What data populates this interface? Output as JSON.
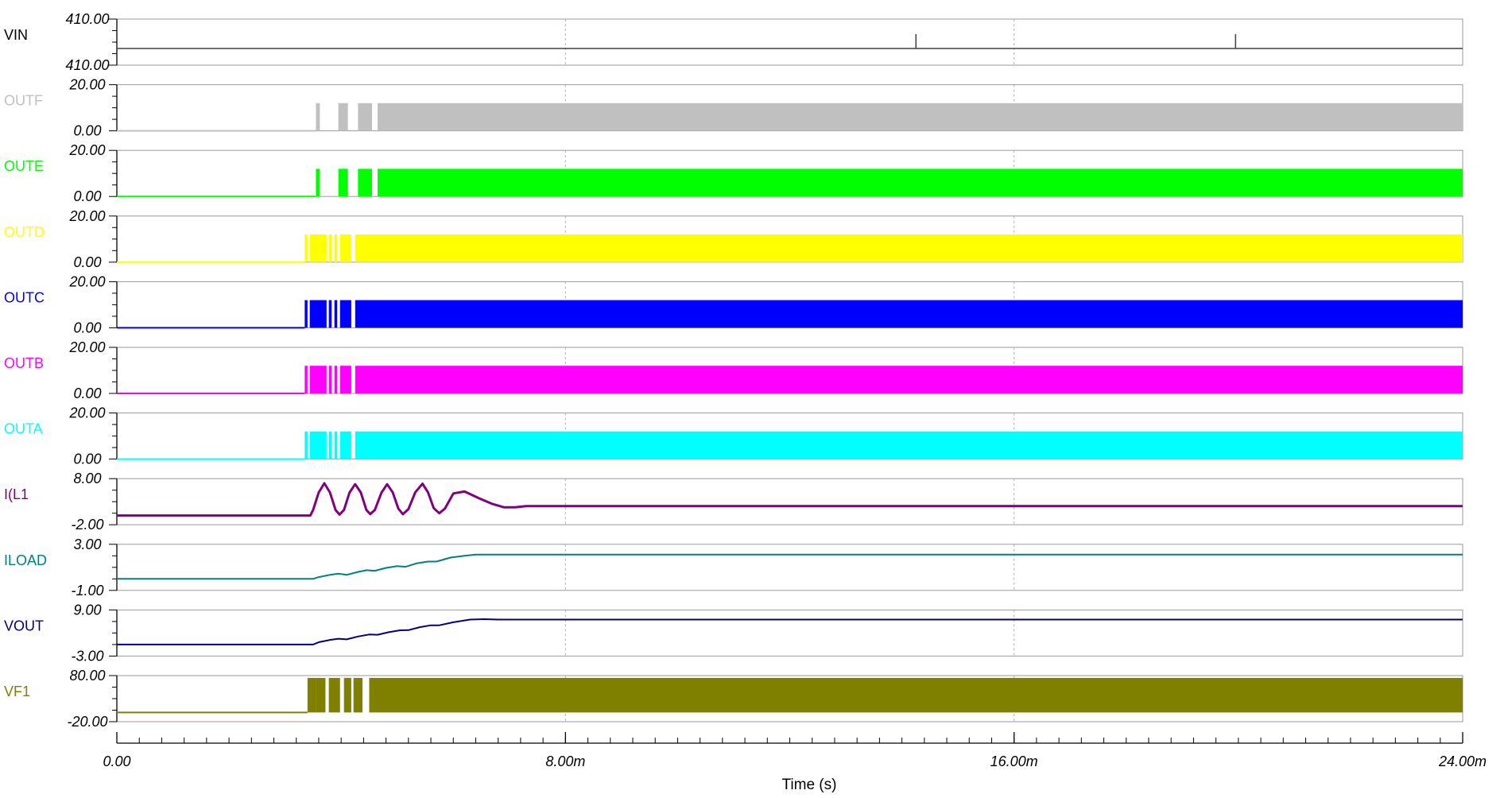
{
  "chart_data": {
    "type": "line",
    "title": "",
    "xlabel": "Time (s)",
    "x_range": [
      0,
      24
    ],
    "x_unit": "ms",
    "x_ticks": [
      0,
      8,
      16,
      24
    ],
    "x_tick_labels": [
      "0.00",
      "8.00m",
      "16.00m",
      "24.00m"
    ],
    "grid": "dashed vertical lines at each labeled x tick",
    "traces": [
      {
        "name": "VIN",
        "color": "#000000",
        "line_color": "#404040",
        "y_top": 410,
        "y_bottom": 410,
        "top_label": "410.00",
        "bottom_label": "410.00",
        "kind": "flat",
        "spikes_x": [
          14.25,
          19.95
        ]
      },
      {
        "name": "OUTF",
        "color": "#c0c0c0",
        "y_top": 20,
        "y_bottom": 0,
        "top_label": "20.00",
        "bottom_label": "0.00",
        "kind": "pwm",
        "high": 12,
        "start": 3.55,
        "steady_from": 4.65,
        "bursts": [
          [
            3.55,
            3.62
          ],
          [
            3.95,
            4.12
          ],
          [
            4.3,
            4.55
          ]
        ]
      },
      {
        "name": "OUTE",
        "color": "#00ff00",
        "y_top": 20,
        "y_bottom": 0,
        "top_label": "20.00",
        "bottom_label": "0.00",
        "kind": "pwm",
        "high": 12,
        "start": 3.55,
        "steady_from": 4.65,
        "bursts": [
          [
            3.55,
            3.62
          ],
          [
            3.95,
            4.12
          ],
          [
            4.3,
            4.55
          ]
        ]
      },
      {
        "name": "OUTD",
        "color": "#ffff00",
        "y_top": 20,
        "y_bottom": 0,
        "top_label": "20.00",
        "bottom_label": "0.00",
        "kind": "pwm",
        "high": 12,
        "start": 3.35,
        "steady_from": 4.25,
        "bursts": [
          [
            3.35,
            3.4
          ],
          [
            3.44,
            3.74
          ],
          [
            3.78,
            3.83
          ],
          [
            3.88,
            3.93
          ],
          [
            3.98,
            4.18
          ]
        ]
      },
      {
        "name": "OUTC",
        "color": "#0000ff",
        "y_top": 20,
        "y_bottom": 0,
        "top_label": "20.00",
        "bottom_label": "0.00",
        "kind": "pwm",
        "high": 12,
        "start": 3.35,
        "steady_from": 4.25,
        "bursts": [
          [
            3.35,
            3.4
          ],
          [
            3.44,
            3.74
          ],
          [
            3.78,
            3.83
          ],
          [
            3.88,
            3.93
          ],
          [
            3.98,
            4.18
          ]
        ]
      },
      {
        "name": "OUTB",
        "color": "#ff00ff",
        "y_top": 20,
        "y_bottom": 0,
        "top_label": "20.00",
        "bottom_label": "0.00",
        "kind": "pwm",
        "high": 12,
        "start": 3.35,
        "steady_from": 4.25,
        "bursts": [
          [
            3.35,
            3.4
          ],
          [
            3.44,
            3.74
          ],
          [
            3.78,
            3.83
          ],
          [
            3.88,
            3.93
          ],
          [
            3.98,
            4.18
          ]
        ]
      },
      {
        "name": "OUTA",
        "color": "#00ffff",
        "y_top": 20,
        "y_bottom": 0,
        "top_label": "20.00",
        "bottom_label": "0.00",
        "kind": "pwm",
        "high": 12,
        "start": 3.35,
        "steady_from": 4.25,
        "bursts": [
          [
            3.35,
            3.4
          ],
          [
            3.44,
            3.74
          ],
          [
            3.78,
            3.83
          ],
          [
            3.88,
            3.93
          ],
          [
            3.98,
            4.18
          ]
        ]
      },
      {
        "name": "I(L1",
        "color": "#800080",
        "y_top": 8,
        "y_bottom": -2,
        "top_label": "8.00",
        "bottom_label": "-2.00",
        "kind": "curve",
        "stroke": 3,
        "points": [
          [
            0,
            0
          ],
          [
            3.45,
            0
          ],
          [
            3.5,
            1.2
          ],
          [
            3.6,
            5.0
          ],
          [
            3.7,
            7.0
          ],
          [
            3.8,
            5.0
          ],
          [
            3.9,
            1.2
          ],
          [
            3.97,
            0.2
          ],
          [
            4.05,
            1.2
          ],
          [
            4.15,
            5.0
          ],
          [
            4.25,
            6.8
          ],
          [
            4.35,
            5.0
          ],
          [
            4.45,
            1.2
          ],
          [
            4.52,
            0.3
          ],
          [
            4.6,
            1.2
          ],
          [
            4.72,
            5.0
          ],
          [
            4.82,
            6.8
          ],
          [
            4.92,
            5.0
          ],
          [
            5.02,
            1.5
          ],
          [
            5.1,
            0.3
          ],
          [
            5.2,
            1.4
          ],
          [
            5.32,
            5.0
          ],
          [
            5.45,
            6.9
          ],
          [
            5.55,
            5.0
          ],
          [
            5.65,
            1.6
          ],
          [
            5.75,
            0.5
          ],
          [
            5.85,
            1.5
          ],
          [
            6.0,
            4.8
          ],
          [
            6.2,
            5.2
          ],
          [
            6.45,
            3.8
          ],
          [
            6.7,
            2.5
          ],
          [
            6.9,
            1.8
          ],
          [
            7.1,
            1.8
          ],
          [
            7.3,
            2.05
          ],
          [
            24,
            2.05
          ]
        ]
      },
      {
        "name": "ILOAD",
        "color": "#008080",
        "y_top": 3,
        "y_bottom": -1,
        "top_label": "3.00",
        "bottom_label": "-1.00",
        "kind": "curve",
        "stroke": 2,
        "points": [
          [
            0,
            0
          ],
          [
            3.5,
            0
          ],
          [
            3.6,
            0.15
          ],
          [
            3.8,
            0.35
          ],
          [
            3.95,
            0.45
          ],
          [
            4.1,
            0.35
          ],
          [
            4.3,
            0.6
          ],
          [
            4.45,
            0.75
          ],
          [
            4.6,
            0.7
          ],
          [
            4.8,
            0.95
          ],
          [
            5.0,
            1.1
          ],
          [
            5.15,
            1.05
          ],
          [
            5.35,
            1.35
          ],
          [
            5.55,
            1.5
          ],
          [
            5.7,
            1.5
          ],
          [
            5.95,
            1.85
          ],
          [
            6.2,
            2.0
          ],
          [
            6.4,
            2.1
          ],
          [
            24,
            2.1
          ]
        ]
      },
      {
        "name": "VOUT",
        "color": "#000080",
        "y_top": 9,
        "y_bottom": -3,
        "top_label": "9.00",
        "bottom_label": "-3.00",
        "kind": "curve",
        "stroke": 2,
        "points": [
          [
            0,
            0
          ],
          [
            3.5,
            0
          ],
          [
            3.6,
            0.6
          ],
          [
            3.8,
            1.2
          ],
          [
            3.95,
            1.5
          ],
          [
            4.1,
            1.35
          ],
          [
            4.3,
            2.1
          ],
          [
            4.5,
            2.6
          ],
          [
            4.65,
            2.55
          ],
          [
            4.85,
            3.2
          ],
          [
            5.05,
            3.7
          ],
          [
            5.2,
            3.75
          ],
          [
            5.4,
            4.5
          ],
          [
            5.6,
            5.0
          ],
          [
            5.75,
            5.0
          ],
          [
            6.0,
            5.8
          ],
          [
            6.3,
            6.5
          ],
          [
            6.55,
            6.6
          ],
          [
            6.8,
            6.5
          ],
          [
            24,
            6.5
          ]
        ]
      },
      {
        "name": "VF1",
        "color": "#808000",
        "y_top": 80,
        "y_bottom": -20,
        "top_label": "80.00",
        "bottom_label": "-20.00",
        "kind": "pwm",
        "high": 75,
        "low": 0,
        "start": 3.4,
        "steady_from": 4.5,
        "bursts": [
          [
            3.4,
            3.55
          ],
          [
            3.55,
            3.72
          ],
          [
            3.78,
            3.98
          ],
          [
            4.05,
            4.18
          ],
          [
            4.22,
            4.38
          ]
        ]
      }
    ]
  }
}
